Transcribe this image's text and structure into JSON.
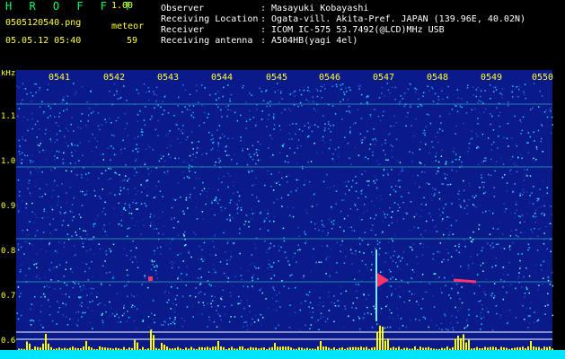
{
  "header": {
    "title": "H R O F F T",
    "version": "1.00",
    "file_name": "0505120540.png",
    "meteor_label": "meteor",
    "timestamp": "05.05.12 05:40",
    "meteor_count": "59"
  },
  "info": [
    {
      "key": "Observer",
      "value": ": Masayuki Kobayashi"
    },
    {
      "key": "Receiving Location",
      "value": ": Ogata-vill. Akita-Pref. JAPAN (139.96E, 40.02N)"
    },
    {
      "key": "Receiver",
      "value": ": ICOM IC-575 53.7492(@LCD)MHz USB"
    },
    {
      "key": "Receiving antenna",
      "value": ": A504HB(yagi 4el)"
    }
  ],
  "spectrogram": {
    "freq_unit": "kHz",
    "freq_ticks": [
      "1.1",
      "1.0",
      "0.9",
      "0.8",
      "0.7",
      "0.6"
    ],
    "time_ticks": [
      "0541",
      "0542",
      "0543",
      "0544",
      "0545",
      "0546",
      "0547",
      "0548",
      "0549",
      "0550"
    ],
    "colors": {
      "background": "#0a1a8a",
      "noise_light": "#3aa0ff",
      "noise_cyan": "#00e0ff",
      "echo": "#ff3366",
      "marker": "#ffff00",
      "baseline": "#00e5ff"
    }
  }
}
